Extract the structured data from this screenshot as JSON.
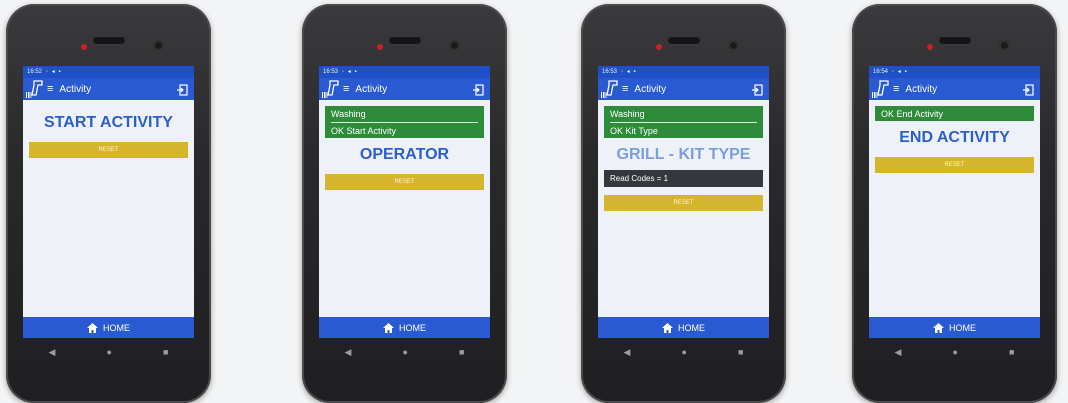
{
  "app": {
    "title": "Activity",
    "home_label": "HOME",
    "reset_label": "RESET"
  },
  "colors": {
    "primary_blue": "#2a5ad1",
    "ok_green": "#2e8b3a",
    "reset_yellow": "#d4b52c",
    "headline_blue": "#2c5fc9"
  },
  "icons": {
    "scanner": "barcode-scanner-icon",
    "menu": "hamburger-menu-icon",
    "exit": "exit-icon",
    "home": "home-icon"
  },
  "phones": [
    {
      "time": "16:52",
      "headline": "START ACTIVITY"
    },
    {
      "time": "16:53",
      "box_line1": "Washing",
      "box_line2": "OK Start Activity",
      "headline": "OPERATOR"
    },
    {
      "time": "16:53",
      "box_line1": "Washing",
      "box_line2": "OK Kit Type",
      "headline": "GRILL - KIT TYPE",
      "info": "Read Codes = 1"
    },
    {
      "time": "16:54",
      "box_line2": "OK End Activity",
      "headline": "END ACTIVITY"
    }
  ],
  "nav": {
    "back": "◀",
    "home": "●",
    "recent": "■"
  }
}
